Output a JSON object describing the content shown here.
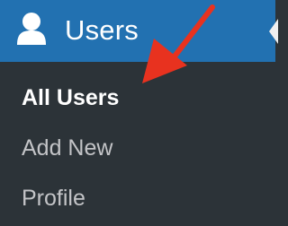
{
  "menu": {
    "title": "Users",
    "icon": "user-icon",
    "submenu": [
      {
        "label": "All Users",
        "current": true
      },
      {
        "label": "Add New",
        "current": false
      },
      {
        "label": "Profile",
        "current": false
      }
    ]
  },
  "colors": {
    "header_background": "#2271b1",
    "menu_background": "#2c3338",
    "current_text": "#ffffff",
    "submenu_text": "#c3c4c7",
    "annotation_arrow": "#e8321f"
  }
}
